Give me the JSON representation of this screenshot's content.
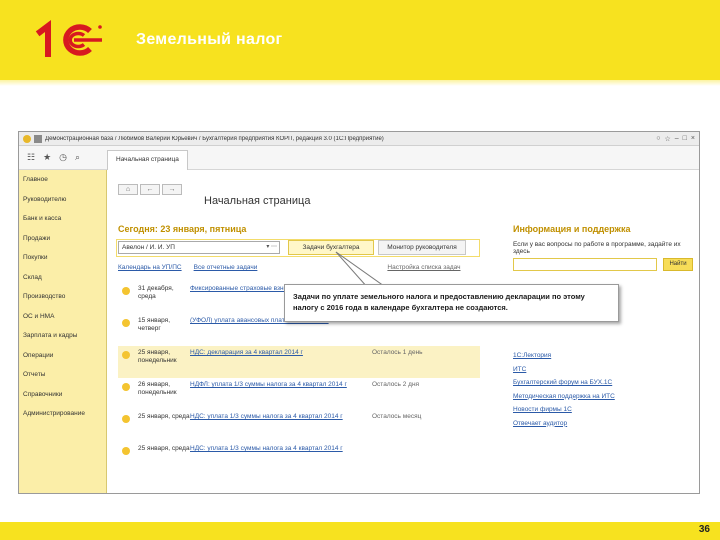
{
  "slide": {
    "title": "Земельный налог",
    "page_number": "36"
  },
  "window": {
    "title": "Демонстрационная база / Любимов Валерий Юрьевич / Бухгалтерия предприятия КОРП, редакция 3.0  (1С:Предприятие)",
    "tab_home": "Начальная страница"
  },
  "sidebar": {
    "items": [
      "Главное",
      "Руководителю",
      "Банк и касса",
      "Продажи",
      "Покупки",
      "Склад",
      "Производство",
      "ОС и НМА",
      "Зарплата и кадры",
      "Операции",
      "Отчеты",
      "Справочники",
      "Администрирование"
    ]
  },
  "main": {
    "page_title": "Начальная страница",
    "today": "Сегодня: 23 января, пятница",
    "org_value": "Авелон / И. И. УП",
    "btn_tasks": "Задачи бухгалтера",
    "btn_monitor": "Монитор руководителя",
    "link_calendar": "Календарь на УП/ПС",
    "link_all_tasks": "Все отчетные задачи",
    "link_right": "Настройка списка задач",
    "rows": [
      {
        "date": "31 декабря, среда",
        "task": "Фиксированные страховые взносы ИП за 2014 г",
        "status": "",
        "selected": false
      },
      {
        "date": "15 января, четверг",
        "task": "(УФОЛ) уплата авансовых платежей за 2014 г",
        "status": "",
        "selected": false
      },
      {
        "date": "25 января, понедельник",
        "task": "НДС: декларация за 4 квартал 2014 г",
        "status": "Осталось 1 день",
        "selected": true
      },
      {
        "date": "26 января, понедельник",
        "task": "НДФЛ: уплата 1/3 суммы налога за 4 квартал 2014 г",
        "status": "Осталось 2 дня",
        "selected": false
      },
      {
        "date": "25 января, среда",
        "task": "НДС: уплата 1/3 суммы налога за 4 квартал 2014 г",
        "status": "Осталось месяц",
        "selected": false
      },
      {
        "date": "25 января, среда",
        "task": "НДС: уплата 1/3 суммы налога за 4 квартал 2014 г",
        "status": "",
        "selected": false
      }
    ]
  },
  "info": {
    "title": "Информация и поддержка",
    "text": "Если у вас вопросы по работе в программе, задайте их здесь",
    "find_label": "Найти",
    "links": [
      "1С:Лектория",
      "ИТС",
      "Бухгалтерский форум на БУХ.1С",
      "Методическая поддержка на ИТС",
      "Новости фирмы 1С",
      "Отвечает аудитор"
    ]
  },
  "callout": {
    "text": "Задачи по уплате земельного налога и предоставлению декларации по этому налогу с 2016 года в календаре бухгалтера не создаются."
  }
}
